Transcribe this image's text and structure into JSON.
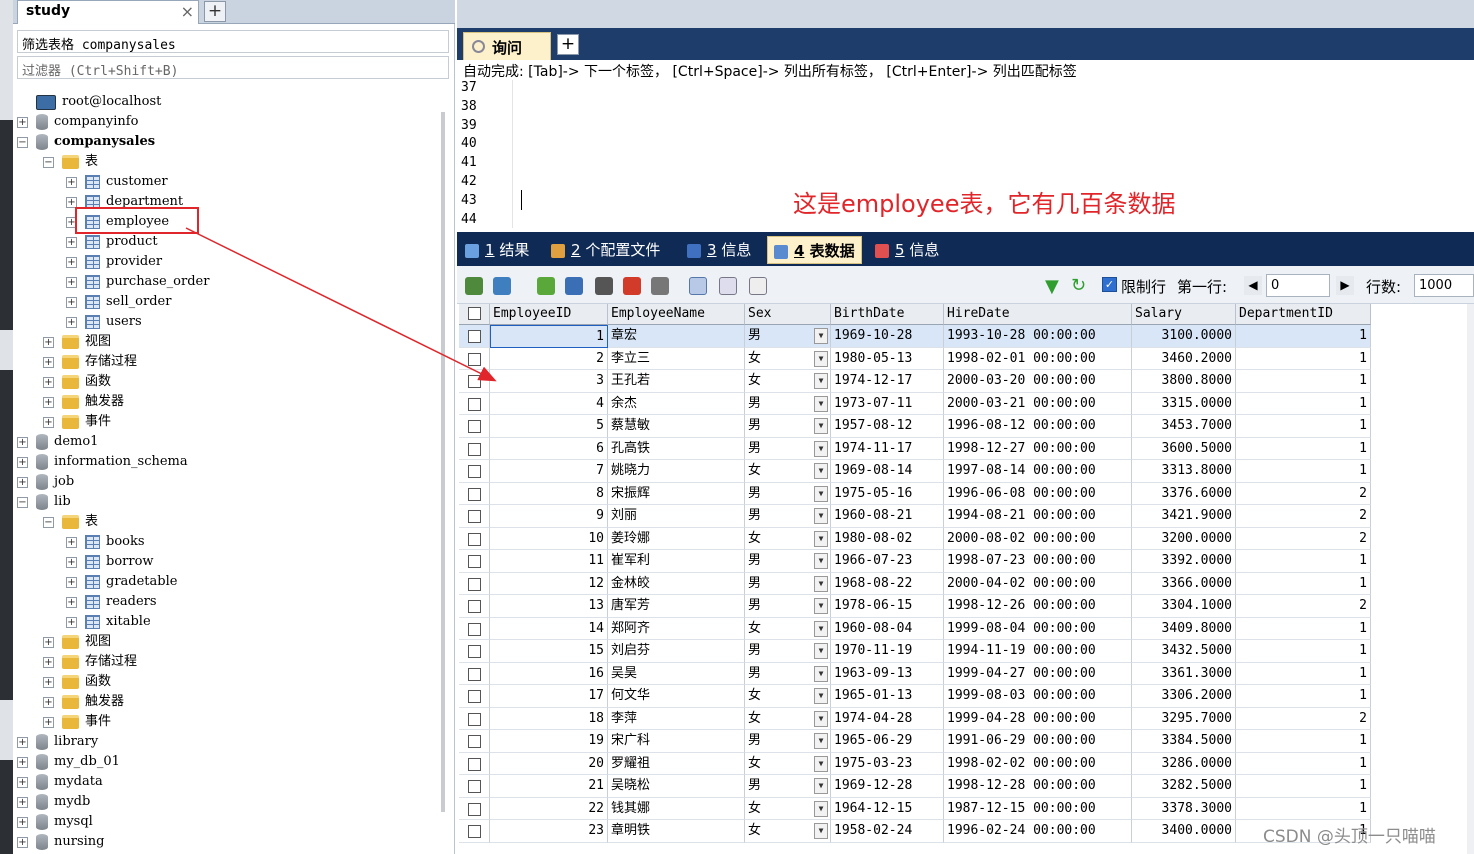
{
  "left_panel": {
    "db_tab": "study",
    "filter_table": "筛选表格 companysales",
    "filter_placeholder": "过滤器 (Ctrl+Shift+B)",
    "tree": [
      {
        "label": "root@localhost",
        "kind": "server",
        "level": 0,
        "exp": ""
      },
      {
        "label": "companyinfo",
        "kind": "db",
        "level": 0,
        "exp": "+"
      },
      {
        "label": "companysales",
        "kind": "db",
        "level": 0,
        "exp": "−",
        "bold": true
      },
      {
        "label": "表",
        "kind": "folder",
        "level": 1,
        "exp": "−"
      },
      {
        "label": "customer",
        "kind": "table",
        "level": 2,
        "exp": "+"
      },
      {
        "label": "department",
        "kind": "table",
        "level": 2,
        "exp": "+"
      },
      {
        "label": "employee",
        "kind": "table",
        "level": 2,
        "exp": "+"
      },
      {
        "label": "product",
        "kind": "table",
        "level": 2,
        "exp": "+"
      },
      {
        "label": "provider",
        "kind": "table",
        "level": 2,
        "exp": "+"
      },
      {
        "label": "purchase_order",
        "kind": "table",
        "level": 2,
        "exp": "+"
      },
      {
        "label": "sell_order",
        "kind": "table",
        "level": 2,
        "exp": "+"
      },
      {
        "label": "users",
        "kind": "table",
        "level": 2,
        "exp": "+"
      },
      {
        "label": "视图",
        "kind": "folder",
        "level": 1,
        "exp": "+"
      },
      {
        "label": "存储过程",
        "kind": "folder",
        "level": 1,
        "exp": "+"
      },
      {
        "label": "函数",
        "kind": "folder",
        "level": 1,
        "exp": "+"
      },
      {
        "label": "触发器",
        "kind": "folder",
        "level": 1,
        "exp": "+"
      },
      {
        "label": "事件",
        "kind": "folder",
        "level": 1,
        "exp": "+"
      },
      {
        "label": "demo1",
        "kind": "db",
        "level": 0,
        "exp": "+"
      },
      {
        "label": "information_schema",
        "kind": "db",
        "level": 0,
        "exp": "+"
      },
      {
        "label": "job",
        "kind": "db",
        "level": 0,
        "exp": "+"
      },
      {
        "label": "lib",
        "kind": "db",
        "level": 0,
        "exp": "−"
      },
      {
        "label": "表",
        "kind": "folder",
        "level": 1,
        "exp": "−"
      },
      {
        "label": "books",
        "kind": "table",
        "level": 2,
        "exp": "+"
      },
      {
        "label": "borrow",
        "kind": "table",
        "level": 2,
        "exp": "+"
      },
      {
        "label": "gradetable",
        "kind": "table",
        "level": 2,
        "exp": "+"
      },
      {
        "label": "readers",
        "kind": "table",
        "level": 2,
        "exp": "+"
      },
      {
        "label": "xitable",
        "kind": "table",
        "level": 2,
        "exp": "+"
      },
      {
        "label": "视图",
        "kind": "folder",
        "level": 1,
        "exp": "+"
      },
      {
        "label": "存储过程",
        "kind": "folder",
        "level": 1,
        "exp": "+"
      },
      {
        "label": "函数",
        "kind": "folder",
        "level": 1,
        "exp": "+"
      },
      {
        "label": "触发器",
        "kind": "folder",
        "level": 1,
        "exp": "+"
      },
      {
        "label": "事件",
        "kind": "folder",
        "level": 1,
        "exp": "+"
      },
      {
        "label": "library",
        "kind": "db",
        "level": 0,
        "exp": "+"
      },
      {
        "label": "my_db_01",
        "kind": "db",
        "level": 0,
        "exp": "+"
      },
      {
        "label": "mydata",
        "kind": "db",
        "level": 0,
        "exp": "+"
      },
      {
        "label": "mydb",
        "kind": "db",
        "level": 0,
        "exp": "+"
      },
      {
        "label": "mysql",
        "kind": "db",
        "level": 0,
        "exp": "+"
      },
      {
        "label": "nursing",
        "kind": "db",
        "level": 0,
        "exp": "+"
      }
    ]
  },
  "query_tab": "询问",
  "autocomplete": "自动完成:  [Tab]-> 下一个标签， [Ctrl+Space]-> 列出所有标签， [Ctrl+Enter]-> 列出匹配标签",
  "line_numbers": [
    "37",
    "38",
    "39",
    "40",
    "41",
    "42",
    "43",
    "44"
  ],
  "note": "这是employee表，它有几百条数据",
  "result_tabs": [
    {
      "num": "1",
      "label": " 结果",
      "color": "#6aa0e0"
    },
    {
      "num": "2",
      "label": " 个配置文件",
      "color": "#e0a040"
    },
    {
      "num": "3",
      "label": " 信息",
      "color": "#4070c0"
    },
    {
      "num": "4",
      "label": " 表数据",
      "color": "#5a8ad0",
      "active": true
    },
    {
      "num": "5",
      "label": " 信息",
      "color": "#e05050"
    }
  ],
  "toolbar": {
    "limit_label": "限制行",
    "first_label": "第一行:",
    "first_value": "0",
    "rows_label": "行数:",
    "rows_value": "1000"
  },
  "columns": [
    "EmployeeID",
    "EmployeeName",
    "Sex",
    "BirthDate",
    "HireDate",
    "Salary",
    "DepartmentID"
  ],
  "rows": [
    [
      "1",
      "章宏",
      "男",
      "1969-10-28",
      "1993-10-28 00:00:00",
      "3100.0000",
      "1"
    ],
    [
      "2",
      "李立三",
      "女",
      "1980-05-13",
      "1998-02-01 00:00:00",
      "3460.2000",
      "1"
    ],
    [
      "3",
      "王孔若",
      "女",
      "1974-12-17",
      "2000-03-20 00:00:00",
      "3800.8000",
      "1"
    ],
    [
      "4",
      "余杰",
      "男",
      "1973-07-11",
      "2000-03-21 00:00:00",
      "3315.0000",
      "1"
    ],
    [
      "5",
      "蔡慧敏",
      "男",
      "1957-08-12",
      "1996-08-12 00:00:00",
      "3453.7000",
      "1"
    ],
    [
      "6",
      "孔高铁",
      "男",
      "1974-11-17",
      "1998-12-27 00:00:00",
      "3600.5000",
      "1"
    ],
    [
      "7",
      "姚晓力",
      "女",
      "1969-08-14",
      "1997-08-14 00:00:00",
      "3313.8000",
      "1"
    ],
    [
      "8",
      "宋振辉",
      "男",
      "1975-05-16",
      "1996-06-08 00:00:00",
      "3376.6000",
      "2"
    ],
    [
      "9",
      "刘丽",
      "男",
      "1960-08-21",
      "1994-08-21 00:00:00",
      "3421.9000",
      "2"
    ],
    [
      "10",
      "姜玲娜",
      "女",
      "1980-08-02",
      "2000-08-02 00:00:00",
      "3200.0000",
      "2"
    ],
    [
      "11",
      "崔军利",
      "男",
      "1966-07-23",
      "1998-07-23 00:00:00",
      "3392.0000",
      "1"
    ],
    [
      "12",
      "金林皎",
      "男",
      "1968-08-22",
      "2000-04-02 00:00:00",
      "3366.0000",
      "1"
    ],
    [
      "13",
      "唐军芳",
      "男",
      "1978-06-15",
      "1998-12-26 00:00:00",
      "3304.1000",
      "2"
    ],
    [
      "14",
      "郑阿齐",
      "女",
      "1960-08-04",
      "1999-08-04 00:00:00",
      "3409.8000",
      "1"
    ],
    [
      "15",
      "刘启芬",
      "男",
      "1970-11-19",
      "1994-11-19 00:00:00",
      "3432.5000",
      "1"
    ],
    [
      "16",
      "吴昊",
      "男",
      "1963-09-13",
      "1999-04-27 00:00:00",
      "3361.3000",
      "1"
    ],
    [
      "17",
      "何文华",
      "女",
      "1965-01-13",
      "1999-08-03 00:00:00",
      "3306.2000",
      "1"
    ],
    [
      "18",
      "李萍",
      "女",
      "1974-04-28",
      "1999-04-28 00:00:00",
      "3295.7000",
      "2"
    ],
    [
      "19",
      "宋广科",
      "男",
      "1965-06-29",
      "1991-06-29 00:00:00",
      "3384.5000",
      "1"
    ],
    [
      "20",
      "罗耀祖",
      "女",
      "1975-03-23",
      "1998-02-02 00:00:00",
      "3286.0000",
      "1"
    ],
    [
      "21",
      "吴晓松",
      "男",
      "1969-12-28",
      "1998-12-28 00:00:00",
      "3282.5000",
      "1"
    ],
    [
      "22",
      "钱其娜",
      "女",
      "1964-12-15",
      "1987-12-15 00:00:00",
      "3378.3000",
      "1"
    ],
    [
      "23",
      "章明铁",
      "女",
      "1958-02-24",
      "1996-02-24 00:00:00",
      "3400.0000",
      "1"
    ]
  ],
  "watermark": "CSDN @头顶一只喵喵",
  "colors": {
    "note": "#e0262a",
    "highlight_box": "#e0262a",
    "tabbar_dark": "#0f2a54",
    "active_tab": "#fdf1cc",
    "selected_row": "#d8e6f8"
  }
}
